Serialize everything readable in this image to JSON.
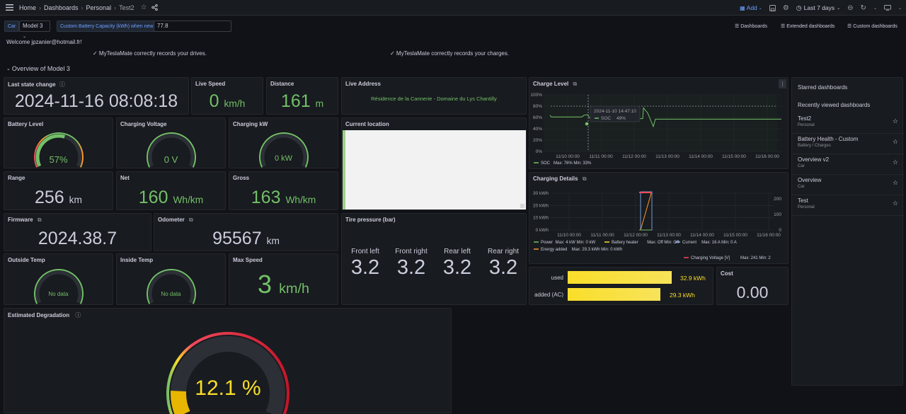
{
  "topbar": {
    "breadcrumbs": [
      "Home",
      "Dashboards",
      "Personal",
      "Test2"
    ],
    "add_label": "Add",
    "time_range": "Last 7 days"
  },
  "vars": {
    "car_label": "Car",
    "car_value": "Model 3",
    "capacity_label": "Custom Battery Capacity (kWh) when new",
    "capacity_value": "77.8"
  },
  "links": {
    "dashboards": "Dashboards",
    "extended": "Extended dashboards",
    "custom": "Custom dashboards"
  },
  "welcome": "Welcome jpzanier@hotmail.fr!",
  "notice_drives": "✓ MyTeslaMate correctly records your drives.",
  "notice_charges": "✓ MyTeslaMate correctly records your charges.",
  "row_title": "Overview of Model 3",
  "panels": {
    "last_state": {
      "title": "Last state change",
      "value": "2024-11-16 08:08:18"
    },
    "live_speed": {
      "title": "Live Speed",
      "value": "0",
      "unit": "km/h"
    },
    "distance": {
      "title": "Distance",
      "value": "161",
      "unit": "m"
    },
    "live_address": {
      "title": "Live Address",
      "value": "Résidence de la Cannerie - Domaine du Lys Chantilly"
    },
    "battery_level": {
      "title": "Battery Level",
      "value": "57%",
      "level": 0.57
    },
    "charging_voltage": {
      "title": "Charging Voltage",
      "value": "0 V"
    },
    "charging_kw": {
      "title": "Charging kW",
      "value": "0 kW"
    },
    "current_location": {
      "title": "Current location"
    },
    "range": {
      "title": "Range",
      "value": "256",
      "unit": "km"
    },
    "net": {
      "title": "Net",
      "value": "160",
      "unit": "Wh/km"
    },
    "gross": {
      "title": "Gross",
      "value": "163",
      "unit": "Wh/km"
    },
    "firmware": {
      "title": "Firmware",
      "value": "2024.38.7"
    },
    "odometer": {
      "title": "Odometer",
      "value": "95567",
      "unit": "km"
    },
    "tire_pressure": {
      "title": "Tire pressure (bar)",
      "tires": [
        {
          "label": "Front left",
          "value": "3.2"
        },
        {
          "label": "Front right",
          "value": "3.2"
        },
        {
          "label": "Rear left",
          "value": "3.2"
        },
        {
          "label": "Rear right",
          "value": "3.2"
        }
      ]
    },
    "outside_temp": {
      "title": "Outside Temp",
      "value": "No data"
    },
    "inside_temp": {
      "title": "Inside Temp",
      "value": "No data"
    },
    "max_speed": {
      "title": "Max Speed",
      "value": "3",
      "unit": "km/h"
    },
    "degradation": {
      "title": "Estimated Degradation",
      "value": "12.1 %",
      "level": 0.121
    },
    "energy": {
      "used_label": "used",
      "used_value": "32.9 kWh",
      "used_fraction": 0.97,
      "added_label": "added (AC)",
      "added_value": "29.3 kWh",
      "added_fraction": 0.86
    },
    "cost": {
      "title": "Cost",
      "value": "0.00"
    }
  },
  "charge_level": {
    "title": "Charge Level",
    "y_ticks": [
      "100%",
      "80%",
      "60%",
      "40%",
      "20%",
      "0%"
    ],
    "x_ticks": [
      "11/10 00:00",
      "11/11 00:00",
      "11/12 00:00",
      "11/13 00:00",
      "11/14 00:00",
      "11/15 00:00",
      "11/16 00:00"
    ],
    "tooltip_time": "2024-11-10 14:47:10",
    "tooltip_series": "SOC",
    "tooltip_value": "49%",
    "legend": "SOC",
    "legend_stats": "Max: 76%   Min: 33%"
  },
  "charging_details": {
    "title": "Charging Details",
    "y_left": [
      "30 kWh",
      "20 kWh",
      "10 kWh",
      "0 kWh"
    ],
    "y_right": [
      "200",
      "100",
      "0"
    ],
    "x_ticks": [
      "11/10 00:00",
      "11/11 00:00",
      "11/12 00:00",
      "11/13 00:00",
      "11/14 00:00",
      "11/15 00:00",
      "11/16 00:00"
    ],
    "legend": [
      {
        "name": "Power",
        "stats": "Max: 4 kW   Min: 0 kW",
        "color": "#73bf69"
      },
      {
        "name": "Battery heater",
        "stats": "Max: Off   Min: Off",
        "color": "#fade2a"
      },
      {
        "name": "Current",
        "stats": "Max: 16 A   Min: 0 A",
        "color": "#8ab8ff"
      },
      {
        "name": "Energy added",
        "stats": "Max: 29.3 kWh   Min: 0 kWh",
        "color": "#ff9830"
      },
      {
        "name": "Charging Voltage [V]",
        "stats": "Max: 241   Min: 2",
        "color": "#f2495c"
      }
    ]
  },
  "sidebar": {
    "starred": "Starred dashboards",
    "recent": "Recently viewed dashboards",
    "items": [
      {
        "title": "Test2",
        "sub": "Personal"
      },
      {
        "title": "Battery Health - Custom",
        "sub": "Battery / Charges"
      },
      {
        "title": "Overview v2",
        "sub": "Car"
      },
      {
        "title": "Overview",
        "sub": "Car"
      },
      {
        "title": "Test",
        "sub": "Personal"
      }
    ]
  },
  "colors": {
    "green": "#73bf69",
    "yellow": "#fade2a",
    "red": "#f2495c",
    "orange": "#ff9830",
    "blue": "#6e9fff"
  }
}
